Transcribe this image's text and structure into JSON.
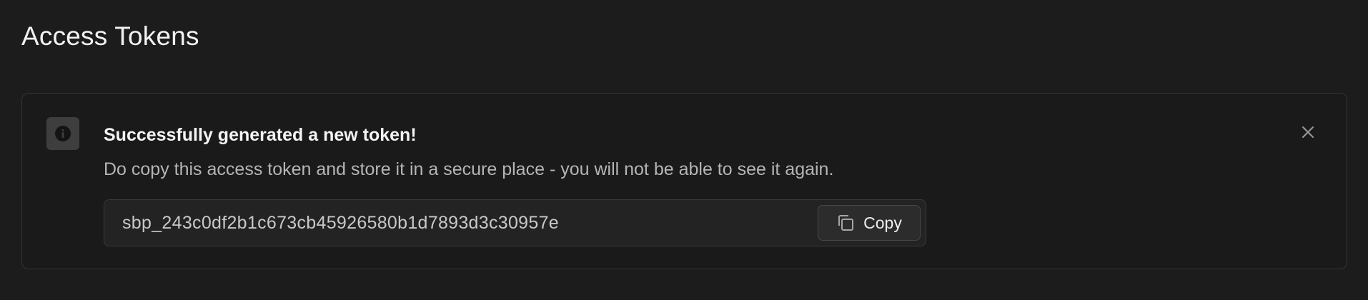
{
  "page": {
    "title": "Access Tokens"
  },
  "alert": {
    "icon": "info-icon",
    "title": "Successfully generated a new token!",
    "description": "Do copy this access token and store it in a secure place - you will not be able to see it again.",
    "close_icon": "close-icon"
  },
  "token": {
    "value": "sbp_243c0df2b1c673cb45926580b1d7893d3c30957e",
    "copy_label": "Copy",
    "copy_icon": "copy-icon"
  },
  "colors": {
    "background": "#1c1c1c",
    "panel_border": "#343434",
    "text_primary": "#f2f2f2",
    "text_secondary": "#b5b5b5"
  }
}
